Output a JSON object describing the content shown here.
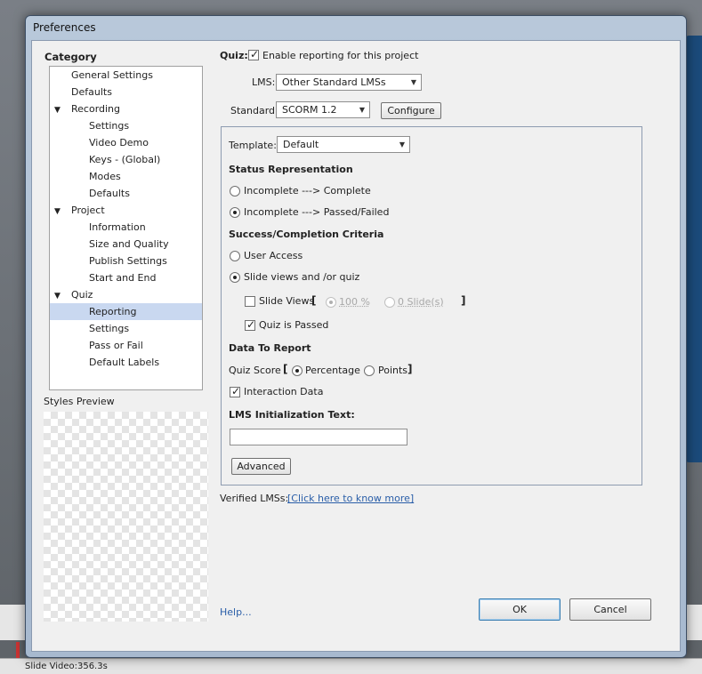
{
  "dialog": {
    "title": "Preferences"
  },
  "sidebar": {
    "category_label": "Category",
    "items": [
      {
        "label": "General Settings"
      },
      {
        "label": "Defaults"
      },
      {
        "label": "Recording"
      },
      {
        "label": "Settings"
      },
      {
        "label": "Video Demo"
      },
      {
        "label": "Keys - (Global)"
      },
      {
        "label": "Modes"
      },
      {
        "label": "Defaults"
      },
      {
        "label": "Project"
      },
      {
        "label": "Information"
      },
      {
        "label": "Size and Quality"
      },
      {
        "label": "Publish Settings"
      },
      {
        "label": "Start and End"
      },
      {
        "label": "Quiz"
      },
      {
        "label": "Reporting"
      },
      {
        "label": "Settings"
      },
      {
        "label": "Pass or Fail"
      },
      {
        "label": "Default Labels"
      }
    ],
    "styles_preview_label": "Styles Preview"
  },
  "quiz": {
    "quiz_label": "Quiz:",
    "enable_reporting_label": "Enable reporting for this project",
    "enable_reporting_checked": true,
    "lms_label": "LMS:",
    "lms_value": "Other Standard LMSs",
    "standard_label": "Standard:",
    "standard_value": "SCORM 1.2",
    "configure_label": "Configure"
  },
  "group": {
    "template_label": "Template:",
    "template_value": "Default",
    "status_heading": "Status Representation",
    "status_options": [
      {
        "label": "Incomplete ---> Complete",
        "checked": false
      },
      {
        "label": "Incomplete ---> Passed/Failed",
        "checked": true
      }
    ],
    "criteria_heading": "Success/Completion Criteria",
    "criteria_options": [
      {
        "label": "User Access",
        "checked": false
      },
      {
        "label": "Slide views and /or quiz",
        "checked": true
      }
    ],
    "slide_views_label": "Slide Views",
    "slide_views_bracket_open": "[",
    "slide_views_bracket_close": "]",
    "slide_views_checked": false,
    "percent_value": "100 %",
    "slides_value": "0 Slide(s)",
    "quiz_passed_label": "Quiz is Passed",
    "quiz_passed_checked": true,
    "data_heading": "Data To Report",
    "quiz_score_label": "Quiz Score",
    "score_bracket_open": "[",
    "score_bracket_close": "]",
    "percentage_label": "Percentage",
    "points_label": "Points",
    "interaction_data_label": "Interaction Data",
    "interaction_data_checked": true,
    "lms_init_heading": "LMS Initialization Text:",
    "lms_init_value": "",
    "advanced_label": "Advanced"
  },
  "footer": {
    "verified_lms_label": "Verified LMSs:",
    "verified_lms_link": "[Click here to know more]",
    "help_link": "Help...",
    "ok_label": "OK",
    "cancel_label": "Cancel"
  },
  "statusbar": {
    "text": "Slide Video:356.3s"
  }
}
